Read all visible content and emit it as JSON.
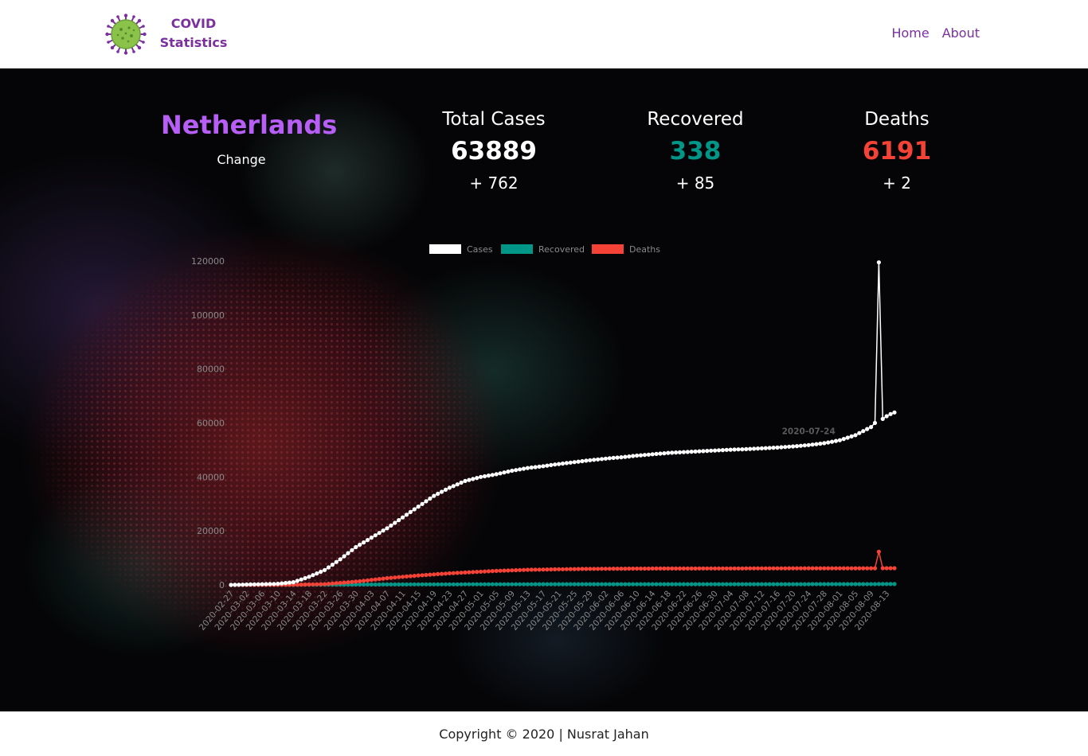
{
  "header": {
    "brand_line1": "COVID",
    "brand_line2": "Statistics",
    "nav": [
      {
        "label": "Home"
      },
      {
        "label": "About"
      }
    ]
  },
  "country": {
    "name": "Netherlands",
    "change_label": "Change"
  },
  "stats": {
    "cases": {
      "title": "Total Cases",
      "value": "63889",
      "change": "+ 762",
      "color": "#ffffff"
    },
    "recovered": {
      "title": "Recovered",
      "value": "338",
      "change": "+ 85",
      "color": "#009688"
    },
    "deaths": {
      "title": "Deaths",
      "value": "6191",
      "change": "+ 2",
      "color": "#f44336"
    }
  },
  "footer": {
    "copyright": "Copyright © 2020 | Nusrat Jahan"
  },
  "chart_data": {
    "type": "line",
    "title": "",
    "xlabel": "",
    "ylabel": "",
    "ylim": [
      0,
      120000
    ],
    "yticks": [
      0,
      20000,
      40000,
      60000,
      80000,
      100000,
      120000
    ],
    "grid": false,
    "legend_position": "top-center",
    "start_date": "2020-02-27",
    "end_date": "2020-08-15",
    "tick_labels": [
      "2020-02-27",
      "2020-03-02",
      "2020-03-06",
      "2020-03-10",
      "2020-03-14",
      "2020-03-18",
      "2020-03-22",
      "2020-03-26",
      "2020-03-30",
      "2020-04-03",
      "2020-04-07",
      "2020-04-11",
      "2020-04-15",
      "2020-04-19",
      "2020-04-23",
      "2020-04-27",
      "2020-05-01",
      "2020-05-05",
      "2020-05-09",
      "2020-05-13",
      "2020-05-17",
      "2020-05-21",
      "2020-05-25",
      "2020-05-29",
      "2020-06-02",
      "2020-06-06",
      "2020-06-10",
      "2020-06-14",
      "2020-06-18",
      "2020-06-22",
      "2020-06-26",
      "2020-06-30",
      "2020-07-04",
      "2020-07-08",
      "2020-07-12",
      "2020-07-16",
      "2020-07-20",
      "2020-07-24",
      "2020-07-28",
      "2020-08-01",
      "2020-08-05",
      "2020-08-09",
      "2020-08-13"
    ],
    "tooltip_label": "2020-07-24",
    "series": [
      {
        "name": "Cases",
        "color": "#ffffff",
        "points": [
          [
            "2020-02-27",
            0
          ],
          [
            "2020-03-10",
            400
          ],
          [
            "2020-03-14",
            1000
          ],
          [
            "2020-03-18",
            3000
          ],
          [
            "2020-03-22",
            5500
          ],
          [
            "2020-03-26",
            9500
          ],
          [
            "2020-03-30",
            14000
          ],
          [
            "2020-04-03",
            17500
          ],
          [
            "2020-04-07",
            21000
          ],
          [
            "2020-04-11",
            25000
          ],
          [
            "2020-04-15",
            29000
          ],
          [
            "2020-04-19",
            33000
          ],
          [
            "2020-04-23",
            36000
          ],
          [
            "2020-04-27",
            38500
          ],
          [
            "2020-05-01",
            40000
          ],
          [
            "2020-05-05",
            41000
          ],
          [
            "2020-05-09",
            42300
          ],
          [
            "2020-05-13",
            43300
          ],
          [
            "2020-05-17",
            44000
          ],
          [
            "2020-05-21",
            44800
          ],
          [
            "2020-05-25",
            45500
          ],
          [
            "2020-05-29",
            46200
          ],
          [
            "2020-06-02",
            46800
          ],
          [
            "2020-06-06",
            47300
          ],
          [
            "2020-06-10",
            47900
          ],
          [
            "2020-06-14",
            48400
          ],
          [
            "2020-06-18",
            48900
          ],
          [
            "2020-06-22",
            49200
          ],
          [
            "2020-06-26",
            49500
          ],
          [
            "2020-06-30",
            49800
          ],
          [
            "2020-07-04",
            50100
          ],
          [
            "2020-07-08",
            50300
          ],
          [
            "2020-07-12",
            50600
          ],
          [
            "2020-07-16",
            50900
          ],
          [
            "2020-07-20",
            51300
          ],
          [
            "2020-07-24",
            51800
          ],
          [
            "2020-07-28",
            52500
          ],
          [
            "2020-08-01",
            53600
          ],
          [
            "2020-08-05",
            55500
          ],
          [
            "2020-08-09",
            58500
          ],
          [
            "2020-08-10",
            60000
          ],
          [
            "2020-08-11",
            119500
          ],
          [
            "2020-08-12",
            61500
          ],
          [
            "2020-08-13",
            62500
          ],
          [
            "2020-08-14",
            63300
          ],
          [
            "2020-08-15",
            63889
          ]
        ]
      },
      {
        "name": "Recovered",
        "color": "#009688",
        "points": [
          [
            "2020-02-27",
            0
          ],
          [
            "2020-03-22",
            100
          ],
          [
            "2020-04-15",
            200
          ],
          [
            "2020-05-13",
            250
          ],
          [
            "2020-06-14",
            260
          ],
          [
            "2020-07-16",
            270
          ],
          [
            "2020-08-09",
            300
          ],
          [
            "2020-08-15",
            338
          ]
        ]
      },
      {
        "name": "Deaths",
        "color": "#f44336",
        "points": [
          [
            "2020-02-27",
            0
          ],
          [
            "2020-03-14",
            50
          ],
          [
            "2020-03-22",
            300
          ],
          [
            "2020-03-30",
            1200
          ],
          [
            "2020-04-07",
            2500
          ],
          [
            "2020-04-15",
            3500
          ],
          [
            "2020-04-23",
            4300
          ],
          [
            "2020-04-27",
            4600
          ],
          [
            "2020-05-05",
            5200
          ],
          [
            "2020-05-13",
            5600
          ],
          [
            "2020-05-21",
            5800
          ],
          [
            "2020-05-29",
            5950
          ],
          [
            "2020-06-10",
            6050
          ],
          [
            "2020-06-30",
            6100
          ],
          [
            "2020-07-20",
            6150
          ],
          [
            "2020-08-09",
            6170
          ],
          [
            "2020-08-10",
            6175
          ],
          [
            "2020-08-11",
            12300
          ],
          [
            "2020-08-12",
            6180
          ],
          [
            "2020-08-13",
            6185
          ],
          [
            "2020-08-14",
            6189
          ],
          [
            "2020-08-15",
            6191
          ]
        ]
      }
    ]
  }
}
